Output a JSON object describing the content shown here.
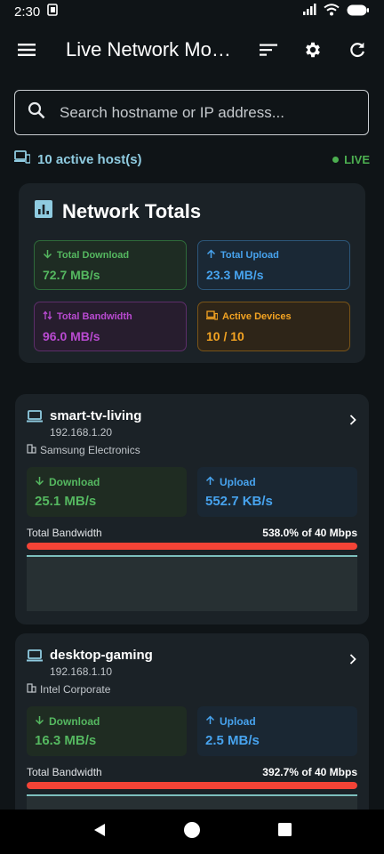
{
  "status_bar": {
    "time": "2:30"
  },
  "app_bar": {
    "title": "Live Network Monitor"
  },
  "search": {
    "placeholder": "Search hostname or IP address..."
  },
  "hosts_summary": {
    "count_label": "10 active host(s)",
    "live_label": "LIVE"
  },
  "totals": {
    "title": "Network Totals",
    "stats": [
      {
        "label": "Total Download",
        "value": "72.7 MB/s"
      },
      {
        "label": "Total Upload",
        "value": "23.3 MB/s"
      },
      {
        "label": "Total Bandwidth",
        "value": "96.0 MB/s"
      },
      {
        "label": "Active Devices",
        "value": "10 / 10"
      }
    ]
  },
  "hosts": [
    {
      "name": "smart-tv-living",
      "ip": "192.168.1.20",
      "vendor": "Samsung Electronics",
      "download_label": "Download",
      "download": "25.1 MB/s",
      "upload_label": "Upload",
      "upload": "552.7 KB/s",
      "bandwidth_label": "Total Bandwidth",
      "bandwidth_value": "538.0% of 40 Mbps",
      "bandwidth_fill": 1.0
    },
    {
      "name": "desktop-gaming",
      "ip": "192.168.1.10",
      "vendor": "Intel Corporate",
      "download_label": "Download",
      "download": "16.3 MB/s",
      "upload_label": "Upload",
      "upload": "2.5 MB/s",
      "bandwidth_label": "Total Bandwidth",
      "bandwidth_value": "392.7% of 40 Mbps",
      "bandwidth_fill": 1.0
    }
  ],
  "colors": {
    "download": "#55b860",
    "upload": "#47a3ee",
    "bandwidth": "#b94ad1",
    "devices": "#f3a322",
    "over_limit": "#f44336",
    "live": "#4caf50"
  }
}
